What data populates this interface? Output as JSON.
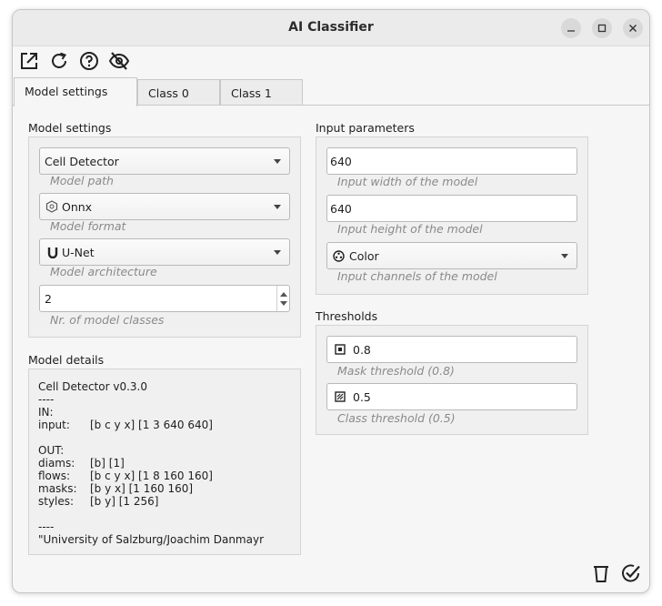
{
  "window": {
    "title": "AI Classifier"
  },
  "toolbar": {
    "icons": [
      "open-external-icon",
      "refresh-icon",
      "help-icon",
      "visibility-off-icon"
    ]
  },
  "tabs": [
    {
      "label": "Model settings",
      "active": true
    },
    {
      "label": "Class 0",
      "active": false
    },
    {
      "label": "Class 1",
      "active": false
    }
  ],
  "model_settings": {
    "title": "Model settings",
    "model_path": {
      "value": "Cell Detector",
      "hint": "Model path"
    },
    "model_format": {
      "value": "Onnx",
      "hint": "Model format",
      "icon": "onnx-icon"
    },
    "model_architecture": {
      "value": "U-Net",
      "hint": "Model architecture",
      "icon": "unet-icon"
    },
    "nr_classes": {
      "value": "2",
      "hint": "Nr. of model classes"
    }
  },
  "model_details": {
    "title": "Model details",
    "header": "Cell Detector v0.3.0",
    "sep1": "----",
    "in_label": "IN:",
    "inputs": [
      {
        "key": "input:",
        "val": "[b c y x] [1 3 640 640]"
      }
    ],
    "out_label": "OUT:",
    "outputs": [
      {
        "key": "diams:",
        "val": "[b] [1]"
      },
      {
        "key": "flows:",
        "val": "[b c y x] [1 8 160 160]"
      },
      {
        "key": "masks:",
        "val": "[b y x] [1 160 160]"
      },
      {
        "key": "styles:",
        "val": "[b y] [1 256]"
      }
    ],
    "sep2": "----",
    "footer": "\"University of Salzburg/Joachim Danmayr"
  },
  "input_parameters": {
    "title": "Input parameters",
    "width": {
      "value": "640",
      "hint": "Input width of the model"
    },
    "height": {
      "value": "640",
      "hint": "Input height of the model"
    },
    "channels": {
      "value": "Color",
      "hint": "Input channels of the model",
      "icon": "color-wheel-icon"
    }
  },
  "thresholds": {
    "title": "Thresholds",
    "mask": {
      "value": "0.8",
      "hint": "Mask threshold (0.8)",
      "icon": "mask-threshold-icon"
    },
    "class": {
      "value": "0.5",
      "hint": "Class threshold (0.5)",
      "icon": "class-threshold-icon"
    }
  },
  "footer_buttons": [
    "delete-icon",
    "confirm-icon"
  ]
}
